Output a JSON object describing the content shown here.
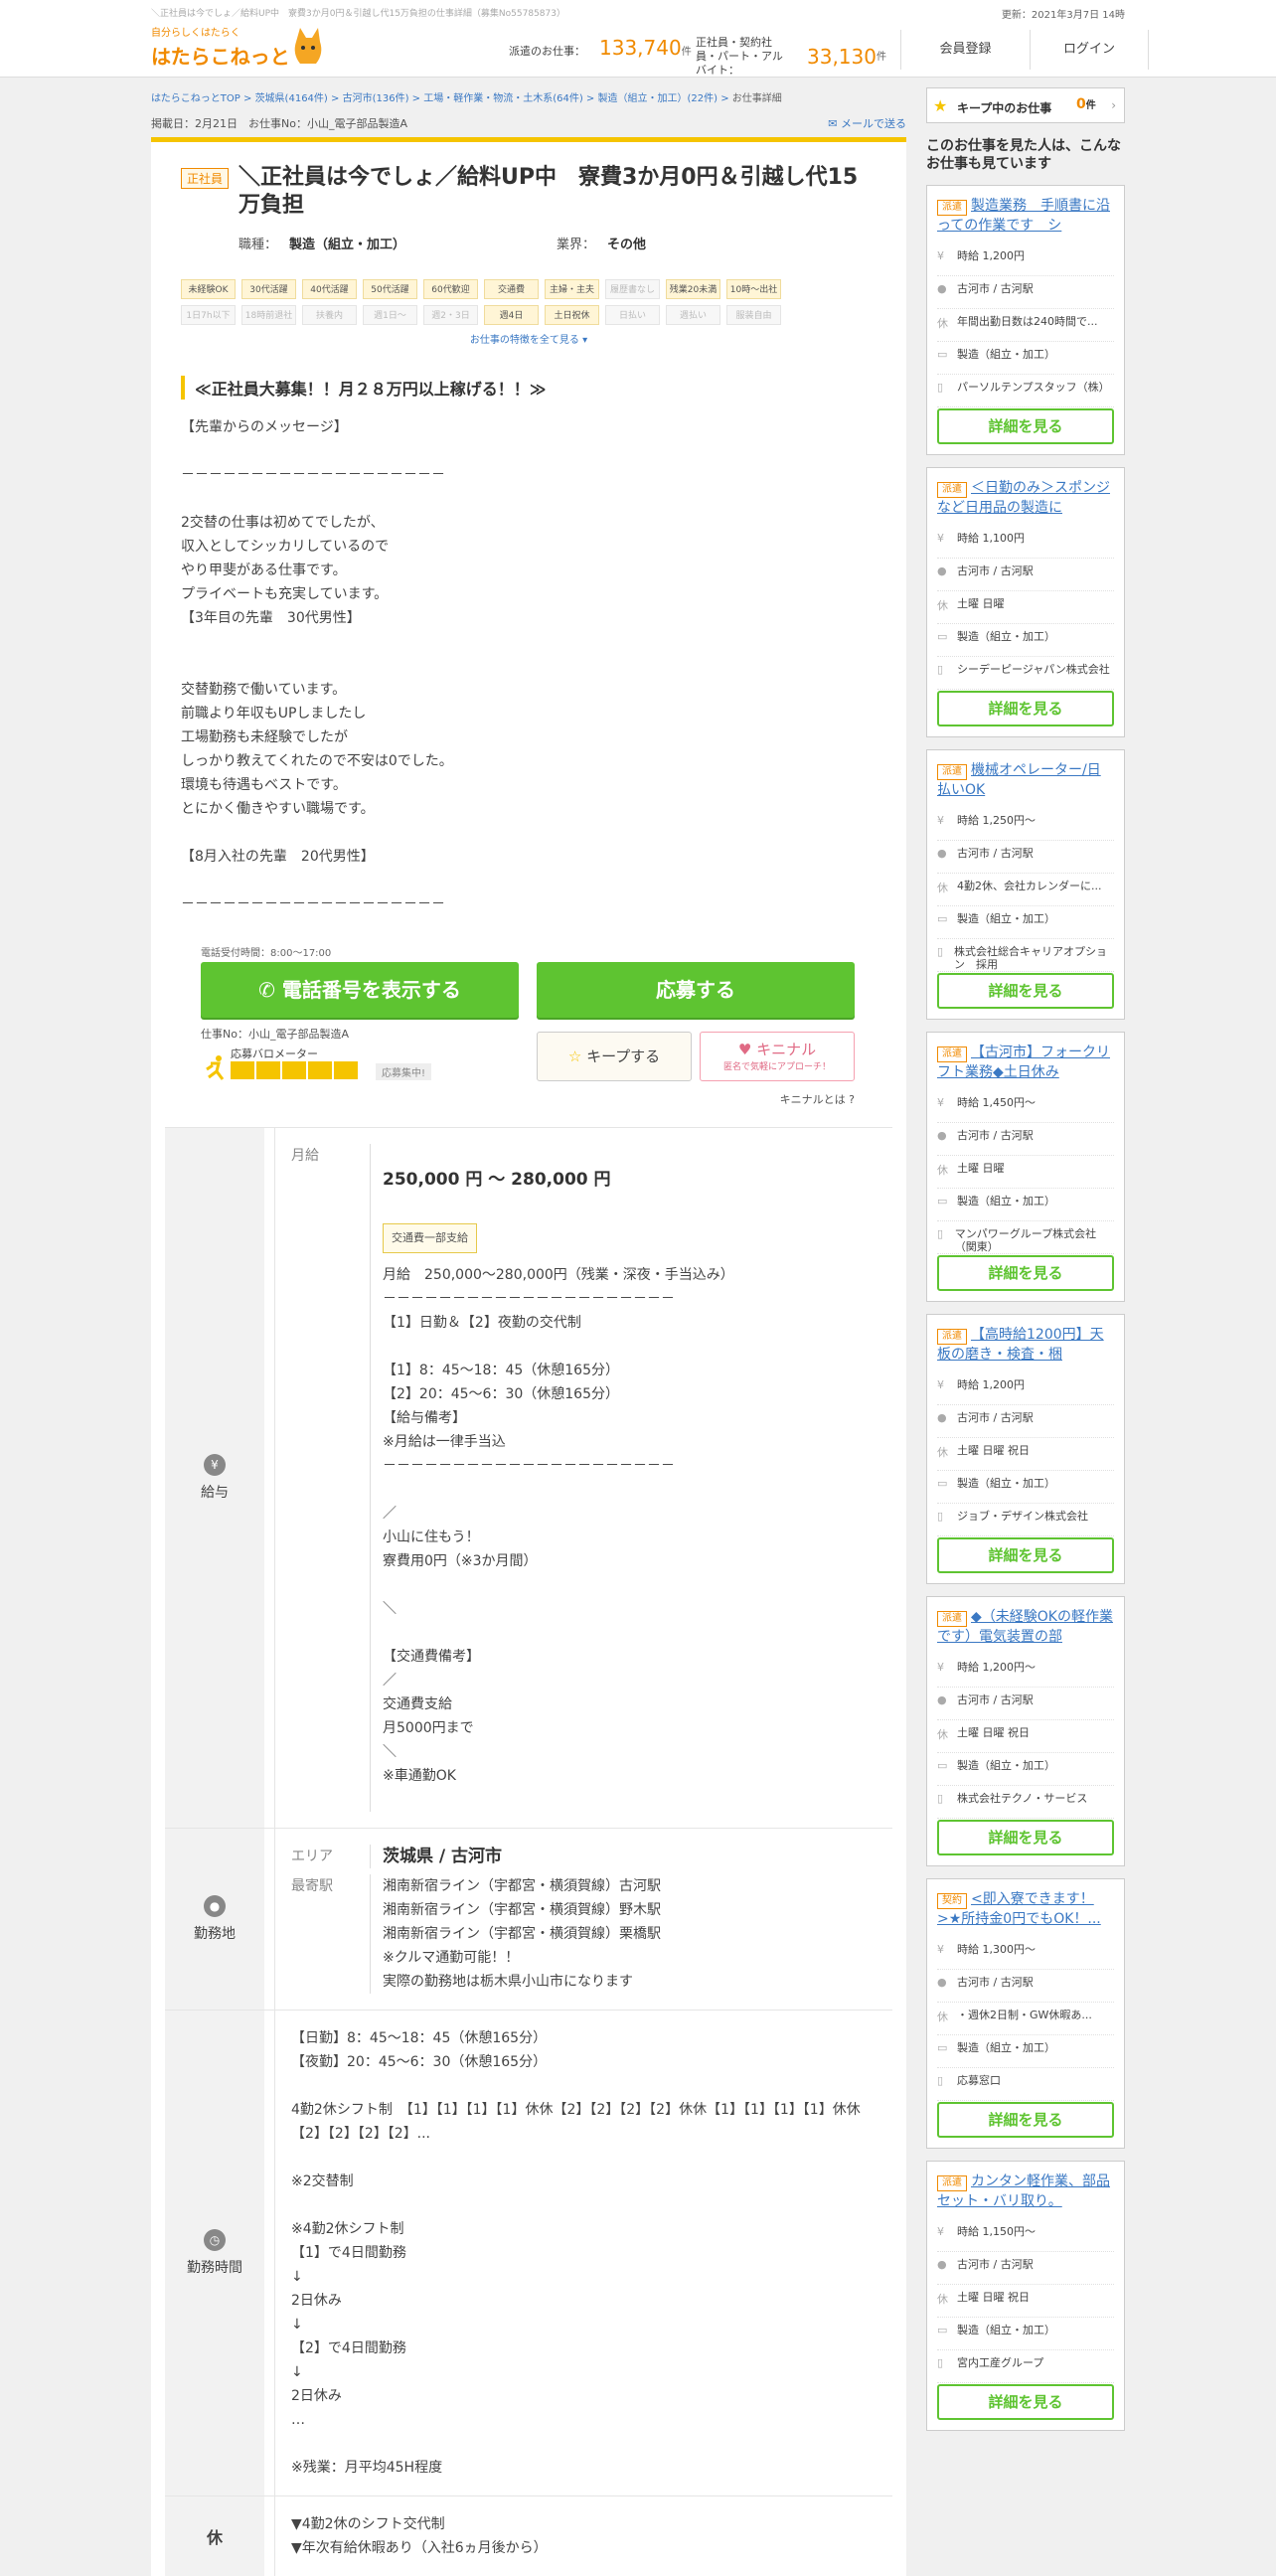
{
  "header": {
    "seo_text": "＼正社員は今でしょ／給料UP中　寮費3か月0円＆引越し代15万負担の仕事詳細（募集No55785873）",
    "update": "更新：2021年3月7日 14時",
    "logo_tagline": "自分らしくはたらく",
    "logo_name": "はたらこねっと",
    "haken_label": "派遣のお仕事：",
    "haken_count": "133,740",
    "unit": "件",
    "sei_label": "正社員・契約社員・パート・アルバイト：",
    "sei_count": "33,130",
    "register": "会員登録",
    "login": "ログイン"
  },
  "breadcrumb": {
    "items": [
      "はたらこねっとTOP",
      "茨城県(4164件)",
      "古河市(136件)",
      "工場・軽作業・物流・土木系(64件)",
      "製造（組立・加工）(22件)"
    ],
    "current": "お仕事詳細"
  },
  "meta": {
    "posted": "掲載日：2月21日　お仕事No：小山_電子部品製造A",
    "mail": "メールで送る"
  },
  "job": {
    "badge": "正社員",
    "title": "＼正社員は今でしょ／給料UP中　寮費3か月0円＆引越し代15万負担",
    "category_label": "職種：",
    "category": "製造（組立・加工）",
    "industry_label": "業界：",
    "industry": "その他"
  },
  "tags": {
    "row1": [
      {
        "text": "未経験OK",
        "on": true
      },
      {
        "text": "30代活躍",
        "on": true
      },
      {
        "text": "40代活躍",
        "on": true
      },
      {
        "text": "50代活躍",
        "on": true
      },
      {
        "text": "60代歓迎",
        "on": true
      },
      {
        "text": "交通費",
        "on": true
      },
      {
        "text": "主婦・主夫",
        "on": true
      },
      {
        "text": "履歴書なし",
        "on": false
      },
      {
        "text": "残業20未満",
        "on": true
      },
      {
        "text": "10時～出社",
        "on": true
      }
    ],
    "row2": [
      {
        "text": "1日7h以下",
        "on": false
      },
      {
        "text": "18時前退社",
        "on": false
      },
      {
        "text": "扶養内",
        "on": false
      },
      {
        "text": "週1日～",
        "on": false
      },
      {
        "text": "週2・3日",
        "on": false
      },
      {
        "text": "週4日",
        "on": true
      },
      {
        "text": "土日祝休",
        "on": true
      },
      {
        "text": "日払い",
        "on": false
      },
      {
        "text": "週払い",
        "on": false
      },
      {
        "text": "服装自由",
        "on": false
      }
    ],
    "more": "お仕事の特徴を全て見る"
  },
  "catch": "≪正社員大募集！！月２８万円以上稼げる！！≫",
  "message": "【先輩からのメッセージ】\n\n－－－－－－－－－－－－－－－－－－－\n\n2交替の仕事は初めてでしたが、\n収入としてシッカリしているので\nやり甲斐がある仕事です。\nプライベートも充実しています。\n【3年目の先輩　30代男性】\n\n\n交替勤務で働いています。\n前職より年収もUPしましたし\n工場勤務も未経験でしたが\nしっかり教えてくれたので不安は0でした。\n環境も待遇もベストです。\nとにかく働きやすい職場です。\n\n【8月入社の先輩　20代男性】\n\n－－－－－－－－－－－－－－－－－－－",
  "apply": {
    "tel_hours": "電話受付時間：8:00～17:00",
    "tel_button": "電話番号を表示する",
    "apply_button": "応募する",
    "job_no": "仕事No：小山_電子部品製造A",
    "barometer_label": "応募バロメーター",
    "barometer_level": 5,
    "barometer_state": "応募集中!",
    "keep_button": "キープする",
    "kininaru_title": "キニナル",
    "kininaru_sub": "匿名で気軽にアプローチ！",
    "kininaru_what": "キニナルとは"
  },
  "salary": {
    "head": "給与",
    "sub_label": "月給",
    "amount": "250,000 円 ～ 280,000 円",
    "tag": "交通費一部支給",
    "body": "月給　250,000～280,000円（残業・深夜・手当込み）\n－－－－－－－－－－－－－－－－－－－－－\n【1】日勤＆【2】夜勤の交代制\n\n【1】8：45～18：45（休憩165分）\n【2】20：45～6：30（休憩165分）\n【給与備考】\n※月給は一律手当込\n－－－－－－－－－－－－－－－－－－－－－\n\n／\n小山に住もう！\n寮費用0円（※3か月間）\n\n＼\n\n【交通費備考】\n／\n交通費支給\n月5000円まで\n＼\n※車通勤OK"
  },
  "location": {
    "head": "勤務地",
    "area_label": "エリア",
    "area": "茨城県 / 古河市",
    "station_label": "最寄駅",
    "stations": "湘南新宿ライン（宇都宮・横須賀線）古河駅\n湘南新宿ライン（宇都宮・横須賀線）野木駅\n湘南新宿ライン（宇都宮・横須賀線）栗橋駅\n※クルマ通勤可能！！\n実際の勤務地は栃木県小山市になります"
  },
  "worktime": {
    "head": "勤務時間",
    "body": "【日勤】8：45～18：45（休憩165分）\n【夜勤】20：45～6：30（休憩165分）\n\n4勤2休シフト制　【1】【1】【1】【1】休休【2】【2】【2】【2】休休【1】【1】【1】【1】休休【2】【2】【2】【2】...\n\n※2交替制\n\n※4勤2休シフト制\n【1】で4日間勤務\n↓\n2日休み\n↓\n【2】で4日間勤務\n↓\n2日休み\n…\n\n※残業：月平均45H程度"
  },
  "holiday": {
    "head": "休",
    "body": "▼4勤2休のシフト交代制\n▼年次有給休暇あり（入社6ヵ月後から）"
  },
  "sidebar": {
    "keep_label": "キープ中のお仕事",
    "keep_count": "0",
    "keep_unit": "件",
    "heading": "このお仕事を見た人は、こんなお仕事も見ています",
    "detail_label": "詳細を見る",
    "cards": [
      {
        "type": "派遣",
        "title": "製造業務　手順書に沿っての作業です　シ",
        "wage": "時給 1,200円",
        "station": "古河市 / 古河駅",
        "holiday": "年間出勤日数は240時間で...",
        "category": "製造（組立・加工）",
        "company": "パーソルテンプスタッフ（株）"
      },
      {
        "type": "派遣",
        "title": "＜日勤のみ＞スポンジなど日用品の製造に",
        "wage": "時給 1,100円",
        "station": "古河市 / 古河駅",
        "holiday": "土曜 日曜",
        "category": "製造（組立・加工）",
        "company": "シーデーピージャパン株式会社"
      },
      {
        "type": "派遣",
        "title": "機械オペレーター/日払いOK",
        "wage": "時給 1,250円～",
        "station": "古河市 / 古河駅",
        "holiday": "4勤2休、会社カレンダーに...",
        "category": "製造（組立・加工）",
        "company": "株式会社総合キャリアオプション　採用"
      },
      {
        "type": "派遣",
        "title": "【古河市】フォークリフト業務◆土日休み",
        "wage": "時給 1,450円～",
        "station": "古河市 / 古河駅",
        "holiday": "土曜 日曜",
        "category": "製造（組立・加工）",
        "company": "マンパワーグループ株式会社（関東）"
      },
      {
        "type": "派遣",
        "title": "【高時給1200円】天板の磨き・検査・梱",
        "wage": "時給 1,200円",
        "station": "古河市 / 古河駅",
        "holiday": "土曜 日曜 祝日",
        "category": "製造（組立・加工）",
        "company": "ジョブ・デザイン株式会社"
      },
      {
        "type": "派遣",
        "title": "◆（未経験OKの軽作業です）電気装置の部",
        "wage": "時給 1,200円～",
        "station": "古河市 / 古河駅",
        "holiday": "土曜 日曜 祝日",
        "category": "製造（組立・加工）",
        "company": "株式会社テクノ・サービス"
      },
      {
        "type": "契約",
        "title": "<即入寮できます！>★所持金0円でもOK！...",
        "wage": "時給 1,300円～",
        "station": "古河市 / 古河駅",
        "holiday": "・週休2日制・GW休暇あ...",
        "category": "製造（組立・加工）",
        "company": "応募窓口"
      },
      {
        "type": "派遣",
        "title": "カンタン軽作業、部品セット・バリ取り。",
        "wage": "時給 1,150円～",
        "station": "古河市 / 古河駅",
        "holiday": "土曜 日曜 祝日",
        "category": "製造（組立・加工）",
        "company": "宮内工産グループ"
      }
    ]
  },
  "colors": {
    "brand_orange": "#f08a00",
    "accent_yellow": "#f5c400",
    "button_green": "#5ec431",
    "link_blue": "#3a78c3"
  }
}
